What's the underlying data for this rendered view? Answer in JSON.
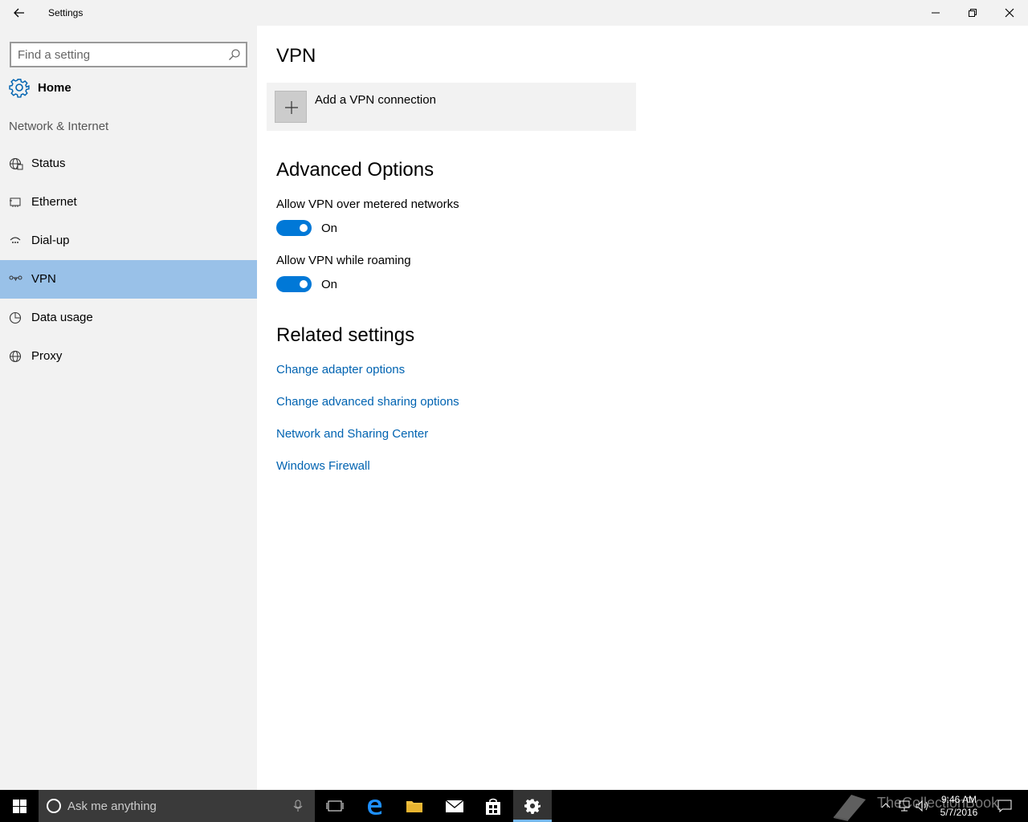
{
  "window": {
    "title": "Settings"
  },
  "sidebar": {
    "search_placeholder": "Find a setting",
    "home_label": "Home",
    "section_label": "Network & Internet",
    "items": [
      {
        "label": "Status",
        "icon": "globe-status-icon"
      },
      {
        "label": "Ethernet",
        "icon": "ethernet-icon"
      },
      {
        "label": "Dial-up",
        "icon": "dialup-icon"
      },
      {
        "label": "VPN",
        "icon": "vpn-icon",
        "selected": true
      },
      {
        "label": "Data usage",
        "icon": "data-usage-icon"
      },
      {
        "label": "Proxy",
        "icon": "globe-icon"
      }
    ]
  },
  "main": {
    "title": "VPN",
    "add_vpn_label": "Add a VPN connection",
    "advanced_title": "Advanced Options",
    "options": [
      {
        "label": "Allow VPN over metered networks",
        "state": "On"
      },
      {
        "label": "Allow VPN while roaming",
        "state": "On"
      }
    ],
    "related_title": "Related settings",
    "links": [
      "Change adapter options",
      "Change advanced sharing options",
      "Network and Sharing Center",
      "Windows Firewall"
    ]
  },
  "taskbar": {
    "search_text": "Ask me anything",
    "time": "9:46 AM",
    "date": "5/7/2016",
    "watermark": "TheCollectionBook"
  },
  "colors": {
    "accent": "#0078d7",
    "link": "#0063b1",
    "selected_nav": "#99c1e8",
    "sidebar_bg": "#f2f2f2"
  }
}
